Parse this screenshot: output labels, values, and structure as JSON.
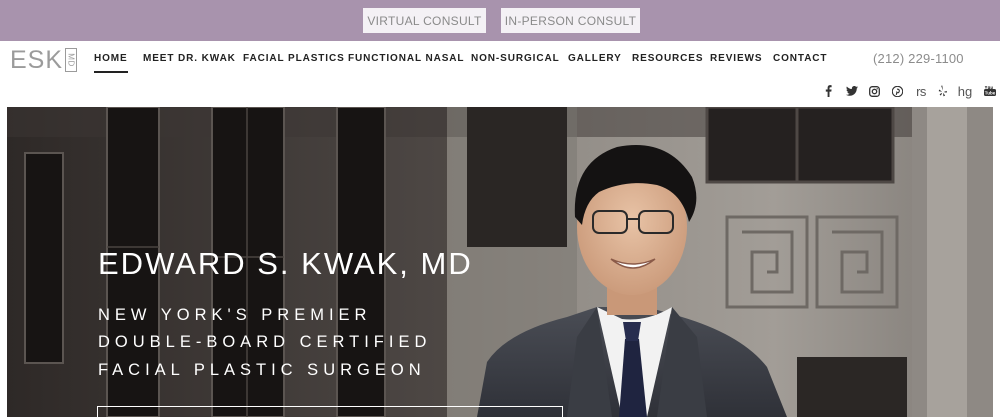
{
  "topbar": {
    "virtual_consult": "VIRTUAL CONSULT",
    "in_person_consult": "IN-PERSON CONSULT"
  },
  "logo": {
    "main": "ESK",
    "sub": "MD"
  },
  "nav": {
    "items": [
      "HOME",
      "MEET DR. KWAK",
      "FACIAL PLASTICS",
      "FUNCTIONAL NASAL",
      "NON-SURGICAL",
      "GALLERY",
      "RESOURCES",
      "REVIEWS",
      "CONTACT"
    ],
    "active": "HOME"
  },
  "phone": "(212) 229-1100",
  "social": [
    {
      "icon": "facebook-icon",
      "label": "f"
    },
    {
      "icon": "twitter-icon",
      "label": ""
    },
    {
      "icon": "instagram-icon",
      "label": ""
    },
    {
      "icon": "pinterest-icon",
      "label": ""
    },
    {
      "icon": "realself-icon",
      "label": "rs"
    },
    {
      "icon": "yelp-icon",
      "label": ""
    },
    {
      "icon": "healthgrades-icon",
      "label": "hg"
    },
    {
      "icon": "youtube-icon",
      "label": ""
    }
  ],
  "hero": {
    "title": "EDWARD S. KWAK, MD",
    "subtitle_line1": "NEW YORK'S PREMIER",
    "subtitle_line2": "DOUBLE-BOARD CERTIFIED",
    "subtitle_line3": "FACIAL PLASTIC SURGEON"
  },
  "colors": {
    "topbar": "#a893ad",
    "consult_button_bg": "#f4f1f5",
    "nav_text": "#222222",
    "phone_text": "#8c8c8c"
  }
}
